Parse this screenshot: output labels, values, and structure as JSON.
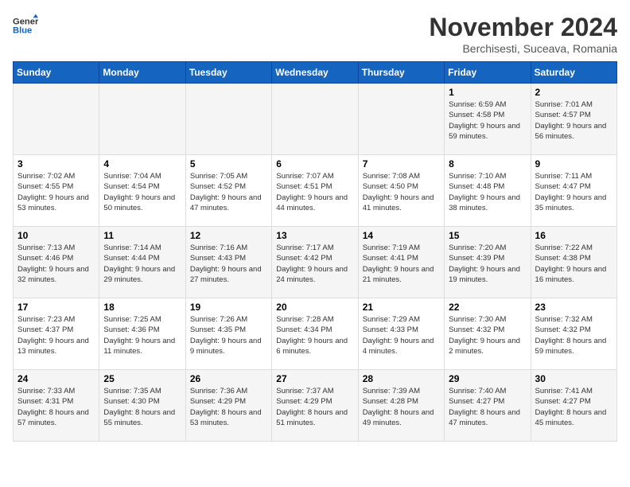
{
  "header": {
    "logo_line1": "General",
    "logo_line2": "Blue",
    "month_title": "November 2024",
    "subtitle": "Berchisesti, Suceava, Romania"
  },
  "weekdays": [
    "Sunday",
    "Monday",
    "Tuesday",
    "Wednesday",
    "Thursday",
    "Friday",
    "Saturday"
  ],
  "weeks": [
    [
      {
        "day": "",
        "info": ""
      },
      {
        "day": "",
        "info": ""
      },
      {
        "day": "",
        "info": ""
      },
      {
        "day": "",
        "info": ""
      },
      {
        "day": "",
        "info": ""
      },
      {
        "day": "1",
        "info": "Sunrise: 6:59 AM\nSunset: 4:58 PM\nDaylight: 9 hours and 59 minutes."
      },
      {
        "day": "2",
        "info": "Sunrise: 7:01 AM\nSunset: 4:57 PM\nDaylight: 9 hours and 56 minutes."
      }
    ],
    [
      {
        "day": "3",
        "info": "Sunrise: 7:02 AM\nSunset: 4:55 PM\nDaylight: 9 hours and 53 minutes."
      },
      {
        "day": "4",
        "info": "Sunrise: 7:04 AM\nSunset: 4:54 PM\nDaylight: 9 hours and 50 minutes."
      },
      {
        "day": "5",
        "info": "Sunrise: 7:05 AM\nSunset: 4:52 PM\nDaylight: 9 hours and 47 minutes."
      },
      {
        "day": "6",
        "info": "Sunrise: 7:07 AM\nSunset: 4:51 PM\nDaylight: 9 hours and 44 minutes."
      },
      {
        "day": "7",
        "info": "Sunrise: 7:08 AM\nSunset: 4:50 PM\nDaylight: 9 hours and 41 minutes."
      },
      {
        "day": "8",
        "info": "Sunrise: 7:10 AM\nSunset: 4:48 PM\nDaylight: 9 hours and 38 minutes."
      },
      {
        "day": "9",
        "info": "Sunrise: 7:11 AM\nSunset: 4:47 PM\nDaylight: 9 hours and 35 minutes."
      }
    ],
    [
      {
        "day": "10",
        "info": "Sunrise: 7:13 AM\nSunset: 4:46 PM\nDaylight: 9 hours and 32 minutes."
      },
      {
        "day": "11",
        "info": "Sunrise: 7:14 AM\nSunset: 4:44 PM\nDaylight: 9 hours and 29 minutes."
      },
      {
        "day": "12",
        "info": "Sunrise: 7:16 AM\nSunset: 4:43 PM\nDaylight: 9 hours and 27 minutes."
      },
      {
        "day": "13",
        "info": "Sunrise: 7:17 AM\nSunset: 4:42 PM\nDaylight: 9 hours and 24 minutes."
      },
      {
        "day": "14",
        "info": "Sunrise: 7:19 AM\nSunset: 4:41 PM\nDaylight: 9 hours and 21 minutes."
      },
      {
        "day": "15",
        "info": "Sunrise: 7:20 AM\nSunset: 4:39 PM\nDaylight: 9 hours and 19 minutes."
      },
      {
        "day": "16",
        "info": "Sunrise: 7:22 AM\nSunset: 4:38 PM\nDaylight: 9 hours and 16 minutes."
      }
    ],
    [
      {
        "day": "17",
        "info": "Sunrise: 7:23 AM\nSunset: 4:37 PM\nDaylight: 9 hours and 13 minutes."
      },
      {
        "day": "18",
        "info": "Sunrise: 7:25 AM\nSunset: 4:36 PM\nDaylight: 9 hours and 11 minutes."
      },
      {
        "day": "19",
        "info": "Sunrise: 7:26 AM\nSunset: 4:35 PM\nDaylight: 9 hours and 9 minutes."
      },
      {
        "day": "20",
        "info": "Sunrise: 7:28 AM\nSunset: 4:34 PM\nDaylight: 9 hours and 6 minutes."
      },
      {
        "day": "21",
        "info": "Sunrise: 7:29 AM\nSunset: 4:33 PM\nDaylight: 9 hours and 4 minutes."
      },
      {
        "day": "22",
        "info": "Sunrise: 7:30 AM\nSunset: 4:32 PM\nDaylight: 9 hours and 2 minutes."
      },
      {
        "day": "23",
        "info": "Sunrise: 7:32 AM\nSunset: 4:32 PM\nDaylight: 8 hours and 59 minutes."
      }
    ],
    [
      {
        "day": "24",
        "info": "Sunrise: 7:33 AM\nSunset: 4:31 PM\nDaylight: 8 hours and 57 minutes."
      },
      {
        "day": "25",
        "info": "Sunrise: 7:35 AM\nSunset: 4:30 PM\nDaylight: 8 hours and 55 minutes."
      },
      {
        "day": "26",
        "info": "Sunrise: 7:36 AM\nSunset: 4:29 PM\nDaylight: 8 hours and 53 minutes."
      },
      {
        "day": "27",
        "info": "Sunrise: 7:37 AM\nSunset: 4:29 PM\nDaylight: 8 hours and 51 minutes."
      },
      {
        "day": "28",
        "info": "Sunrise: 7:39 AM\nSunset: 4:28 PM\nDaylight: 8 hours and 49 minutes."
      },
      {
        "day": "29",
        "info": "Sunrise: 7:40 AM\nSunset: 4:27 PM\nDaylight: 8 hours and 47 minutes."
      },
      {
        "day": "30",
        "info": "Sunrise: 7:41 AM\nSunset: 4:27 PM\nDaylight: 8 hours and 45 minutes."
      }
    ]
  ]
}
